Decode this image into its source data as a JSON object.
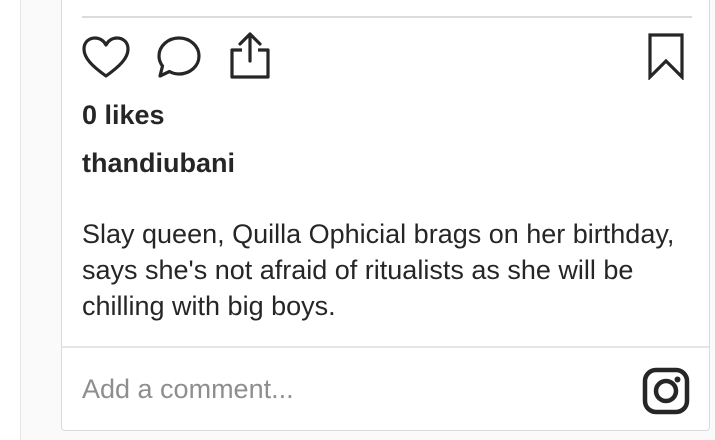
{
  "post": {
    "likes_text": "0 likes",
    "username": "thandiubani",
    "caption": "Slay queen, Quilla Ophicial brags on her birthday, says she's not afraid of ritualists as she will be chilling with big boys."
  },
  "actions": {
    "like_icon": "heart-outline",
    "comment_icon": "speech-bubble",
    "share_icon": "share-upload",
    "save_icon": "bookmark-outline"
  },
  "comment": {
    "placeholder": "Add a comment..."
  },
  "brand": {
    "logo_icon": "instagram-logo"
  },
  "colors": {
    "text": "#262626",
    "placeholder": "#8e8e8e",
    "border": "#dbdbdb",
    "background": "#fafafa"
  }
}
